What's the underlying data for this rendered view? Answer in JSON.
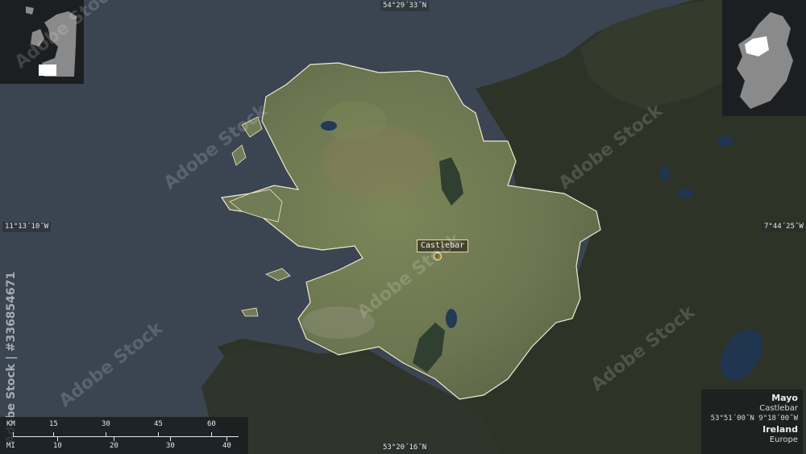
{
  "coordinates": {
    "top": "54°29´33˝N",
    "bottom": "53°20´16˝N",
    "left": "11°13´10˝W",
    "right": "7°44´25˝W"
  },
  "place_label": "Castlebar",
  "scalebar": {
    "km_label": "KM",
    "km_ticks": [
      "15",
      "30",
      "45",
      "60"
    ],
    "mi_label": "MI",
    "mi_ticks": [
      "10",
      "20",
      "30",
      "40"
    ]
  },
  "info": {
    "region": "Mayo",
    "capital": "Castlebar",
    "capital_coords": "53°51´00˝N 9°18´00˝W",
    "country": "Ireland",
    "continent": "Europe"
  },
  "watermark": {
    "text": "Adobe Stock",
    "side_text": "Adobe Stock | #336854671"
  },
  "colors": {
    "sea": "#3b4652",
    "land_dark": "#2b2f26",
    "region": "#6f7a52",
    "region_outline": "#f2ead0",
    "marker": "#7a6a1e"
  }
}
